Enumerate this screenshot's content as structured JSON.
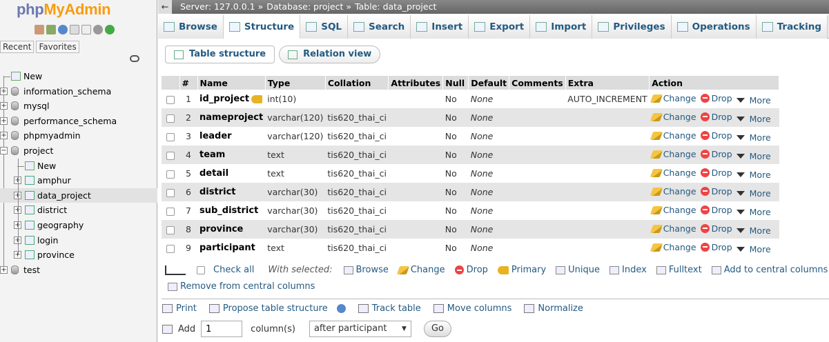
{
  "sidebar": {
    "logo_part1": "php",
    "logo_part2": "MyAdmin",
    "tabs": [
      "Recent",
      "Favorites"
    ],
    "tree": [
      {
        "label": "New",
        "type": "new"
      },
      {
        "label": "information_schema",
        "type": "db"
      },
      {
        "label": "mysql",
        "type": "db"
      },
      {
        "label": "performance_schema",
        "type": "db"
      },
      {
        "label": "phpmyadmin",
        "type": "db"
      },
      {
        "label": "project",
        "type": "db"
      },
      {
        "label": "New",
        "type": "new-child"
      },
      {
        "label": "amphur",
        "type": "table"
      },
      {
        "label": "data_project",
        "type": "table"
      },
      {
        "label": "district",
        "type": "table"
      },
      {
        "label": "geography",
        "type": "table"
      },
      {
        "label": "login",
        "type": "table"
      },
      {
        "label": "province",
        "type": "table"
      },
      {
        "label": "test",
        "type": "db"
      }
    ]
  },
  "breadcrumb": {
    "server": "Server: 127.0.0.1 »",
    "database": "Database: project »",
    "table": "Table: data_project"
  },
  "tabs": [
    "Browse",
    "Structure",
    "SQL",
    "Search",
    "Insert",
    "Export",
    "Import",
    "Privileges",
    "Operations",
    "Tracking"
  ],
  "subtabs": [
    "Table structure",
    "Relation view"
  ],
  "columns_header": [
    "#",
    "Name",
    "Type",
    "Collation",
    "Attributes",
    "Null",
    "Default",
    "Comments",
    "Extra",
    "Action"
  ],
  "rows": [
    {
      "num": "1",
      "name": "id_project",
      "type": "int(10)",
      "collation": "",
      "null": "No",
      "default": "None",
      "extra": "AUTO_INCREMENT",
      "primary": true
    },
    {
      "num": "2",
      "name": "nameproject",
      "type": "varchar(120)",
      "collation": "tis620_thai_ci",
      "null": "No",
      "default": "None",
      "extra": ""
    },
    {
      "num": "3",
      "name": "leader",
      "type": "varchar(120)",
      "collation": "tis620_thai_ci",
      "null": "No",
      "default": "None",
      "extra": ""
    },
    {
      "num": "4",
      "name": "team",
      "type": "text",
      "collation": "tis620_thai_ci",
      "null": "No",
      "default": "None",
      "extra": ""
    },
    {
      "num": "5",
      "name": "detail",
      "type": "text",
      "collation": "tis620_thai_ci",
      "null": "No",
      "default": "None",
      "extra": ""
    },
    {
      "num": "6",
      "name": "district",
      "type": "varchar(30)",
      "collation": "tis620_thai_ci",
      "null": "No",
      "default": "None",
      "extra": ""
    },
    {
      "num": "7",
      "name": "sub_district",
      "type": "varchar(30)",
      "collation": "tis620_thai_ci",
      "null": "No",
      "default": "None",
      "extra": ""
    },
    {
      "num": "8",
      "name": "province",
      "type": "varchar(30)",
      "collation": "tis620_thai_ci",
      "null": "No",
      "default": "None",
      "extra": ""
    },
    {
      "num": "9",
      "name": "participant",
      "type": "text",
      "collation": "tis620_thai_ci",
      "null": "No",
      "default": "None",
      "extra": ""
    }
  ],
  "row_actions": {
    "change": "Change",
    "drop": "Drop",
    "more": "More"
  },
  "bulk": {
    "check_all": "Check all",
    "with_selected": "With selected:",
    "buttons": [
      "Browse",
      "Change",
      "Drop",
      "Primary",
      "Unique",
      "Index",
      "Fulltext",
      "Add to central columns"
    ],
    "remove_central": "Remove from central columns"
  },
  "bottom_links": [
    "Print",
    "Propose table structure",
    "Track table",
    "Move columns",
    "Normalize"
  ],
  "add_columns": {
    "add_label": "Add",
    "count": "1",
    "columns_label": "column(s)",
    "position": "after participant",
    "go": "Go"
  }
}
